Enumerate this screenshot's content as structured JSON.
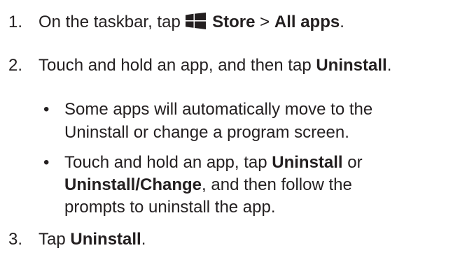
{
  "colors": {
    "text": "#231f20",
    "background": "#ffffff"
  },
  "steps": [
    {
      "number": "1.",
      "prefix": "On the taskbar, tap",
      "icon": "windows-logo-icon",
      "bold1": "Store",
      "sep": ">",
      "bold2": "All apps",
      "end": "."
    },
    {
      "number": "2.",
      "prefix": "Touch and hold an app, and then tap",
      "bold1": "Uninstall",
      "end": "."
    },
    {
      "number": "3.",
      "prefix": "Tap",
      "bold1": "Uninstall",
      "end": "."
    }
  ],
  "bullets": [
    {
      "marker": "•",
      "line1": "Some apps will automatically move to the",
      "line2": "Uninstall or change a program screen."
    },
    {
      "marker": "•",
      "line1_prefix": "Touch and hold an app, tap",
      "line1_bold": "Uninstall",
      "line1_suffix": "or",
      "line2_bold": "Uninstall/Change",
      "line2_suffix": ", and then follow the",
      "line3": "prompts to uninstall the app."
    }
  ]
}
